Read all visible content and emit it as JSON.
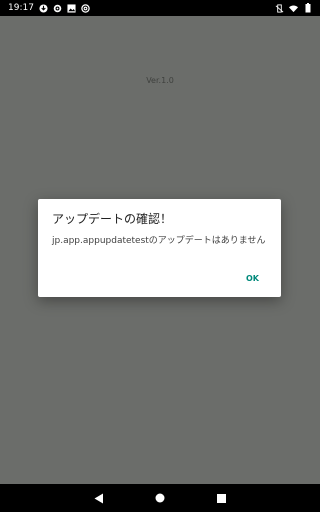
{
  "status_bar": {
    "time": "19:17",
    "left_icons": [
      "download-icon",
      "gear-icon",
      "image-icon",
      "at-icon"
    ],
    "right_icons": [
      "vibrate-icon",
      "wifi-icon",
      "battery-icon"
    ]
  },
  "app": {
    "version": "Ver.1.0"
  },
  "dialog": {
    "title": "アップデートの確認！",
    "message": "jp.app.appupdatetestのアップデートはありません",
    "ok_label": "OK"
  },
  "colors": {
    "background": "#6b6d6a",
    "accent": "#00897b"
  }
}
